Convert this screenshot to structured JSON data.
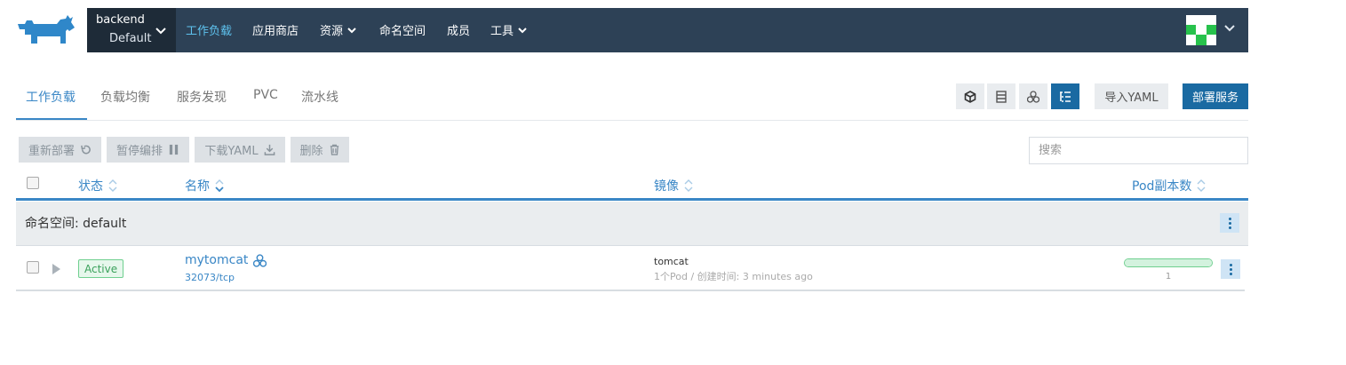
{
  "topnav": {
    "logo_icon": "rancher-cow-logo",
    "cluster_name": "backend",
    "project_name": "Default",
    "items": [
      {
        "label": "工作负载",
        "active": true,
        "dropdown": false
      },
      {
        "label": "应用商店",
        "active": false,
        "dropdown": false
      },
      {
        "label": "资源",
        "active": false,
        "dropdown": true
      },
      {
        "label": "命名空间",
        "active": false,
        "dropdown": false
      },
      {
        "label": "成员",
        "active": false,
        "dropdown": false
      },
      {
        "label": "工具",
        "active": false,
        "dropdown": true
      }
    ]
  },
  "subtabs": [
    {
      "label": "工作负载",
      "active": true
    },
    {
      "label": "负载均衡",
      "active": false
    },
    {
      "label": "服务发现",
      "active": false
    },
    {
      "label": "PVC",
      "active": false
    },
    {
      "label": "流水线",
      "active": false
    }
  ],
  "view_buttons": [
    {
      "icon": "cube-icon",
      "active": false
    },
    {
      "icon": "server-icon",
      "active": false
    },
    {
      "icon": "cluster-nodes-icon",
      "active": false
    },
    {
      "icon": "list-tree-icon",
      "active": true
    }
  ],
  "toolbar": {
    "import_yaml": "导入YAML",
    "deploy": "部署服务"
  },
  "actions": {
    "redeploy": "重新部署",
    "pause": "暂停编排",
    "download_yaml": "下载YAML",
    "delete": "删除"
  },
  "search": {
    "placeholder": "搜索",
    "value": ""
  },
  "table": {
    "headers": {
      "state": "状态",
      "name": "名称",
      "image": "镜像",
      "pods": "Pod副本数"
    },
    "group_label": "命名空间: default",
    "rows": [
      {
        "state": "Active",
        "name": "mytomcat",
        "port": "32073/tcp",
        "image": "tomcat",
        "image_meta": "1个Pod / 创建时间: 3 minutes ago",
        "pod_count": "1",
        "pod_ready_fraction": 1.0
      }
    ]
  },
  "colors": {
    "nav_bg": "#2d4156",
    "accent": "#3a87c6",
    "primary_button": "#1a6aa2",
    "active_green": "#3aa15b"
  }
}
